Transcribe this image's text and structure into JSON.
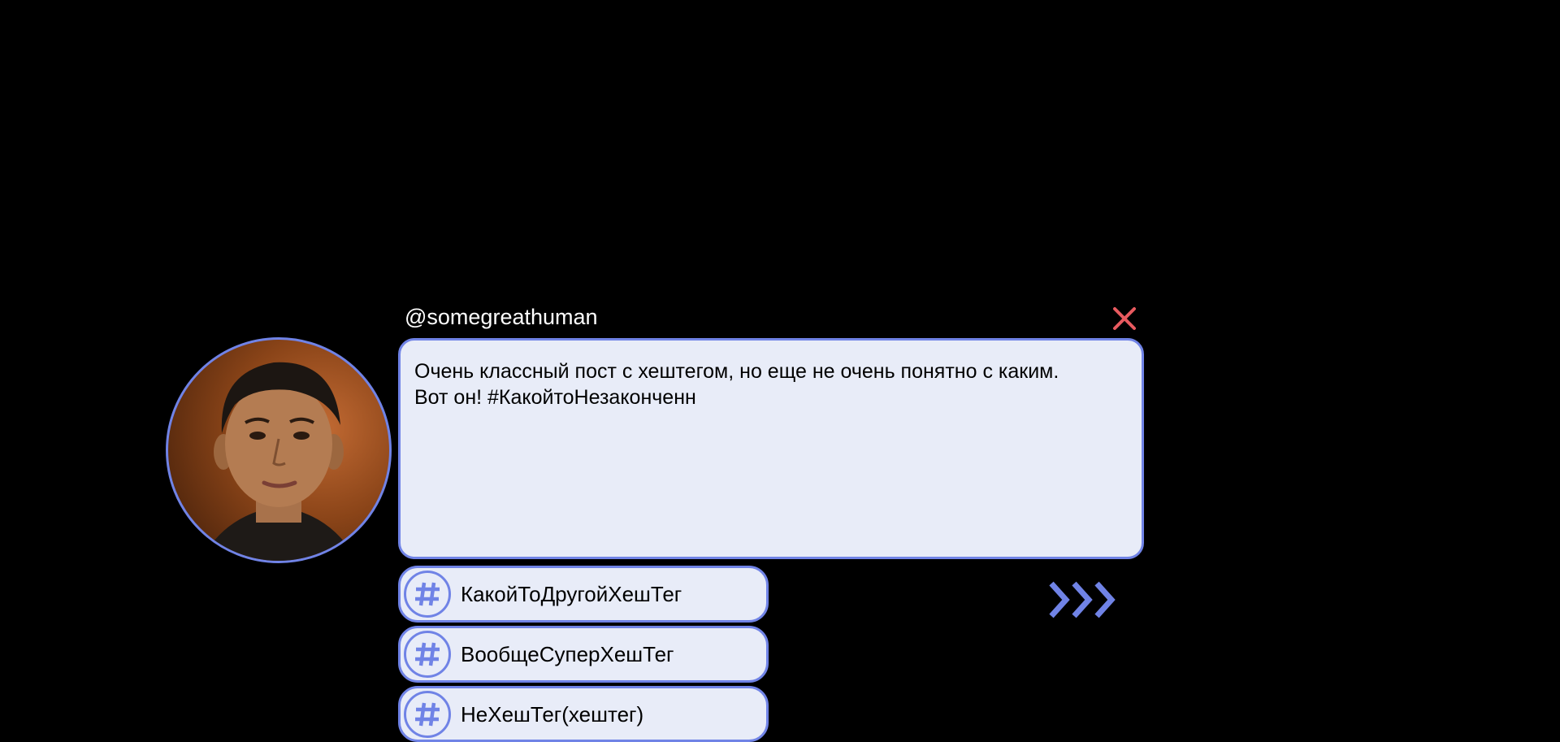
{
  "post": {
    "username": "@somegreathuman",
    "text": "Очень классный пост с хештегом, но еще не очень понятно с каким. Вот он! #КакойтоНезаконченн"
  },
  "suggestions": [
    {
      "label": "КакойТоДругойХешТег"
    },
    {
      "label": "ВообщеСуперХешТег"
    },
    {
      "label": "НеХешТег(хештег)"
    }
  ],
  "colors": {
    "accent": "#7083e6",
    "panel": "#e8ecf8",
    "close": "#e85a5f",
    "background": "#000000"
  },
  "icons": {
    "close": "close-icon",
    "hashtag": "hashtag-icon",
    "next": "chevrons-right-icon"
  }
}
